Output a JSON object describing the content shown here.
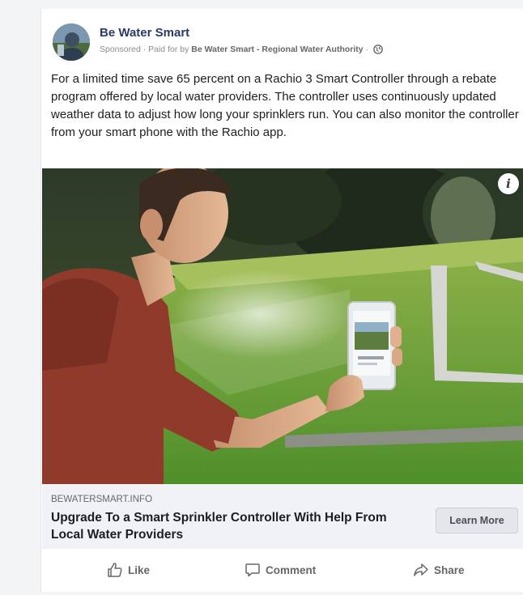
{
  "post": {
    "page_name": "Be Water Smart",
    "sponsored_label": "Sponsored",
    "paid_for_prefix": "· Paid for by",
    "paid_for_by": "Be Water Smart - Regional Water Authority",
    "separator": "·",
    "body_text": "For a limited time save 65 percent on a Rachio 3 Smart Controller through a rebate program offered by local water providers. The controller uses continuously updated weather data to adjust how long your sprinklers run. You can also monitor the controller from your smart phone with the Rachio app."
  },
  "media": {
    "info_icon": "info-icon",
    "info_label": "i"
  },
  "link": {
    "domain": "BEWATERSMART.INFO",
    "headline": "Upgrade To a Smart Sprinkler Controller With Help From Local Water Providers",
    "cta_label": "Learn More"
  },
  "actions": {
    "like_label": "Like",
    "comment_label": "Comment",
    "share_label": "Share"
  },
  "colors": {
    "page_name": "#2b3a66",
    "secondary_text": "#65676b",
    "link_box_bg": "#f0f2f5"
  }
}
